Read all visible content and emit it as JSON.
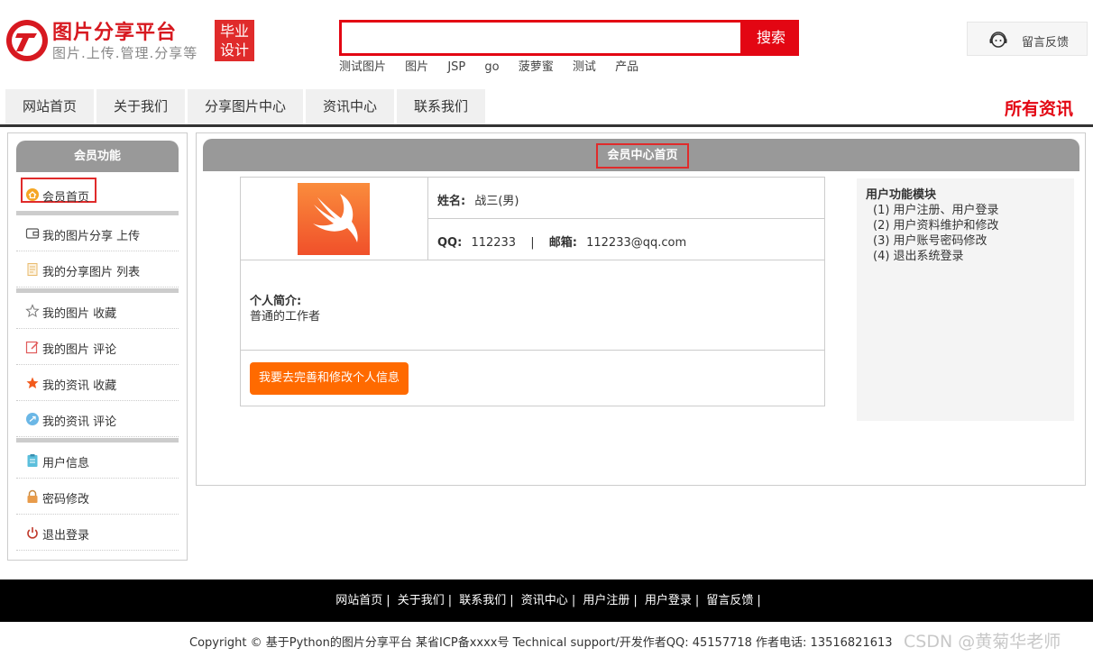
{
  "header": {
    "brand_title": "图片分享平台",
    "brand_subtitle": "图片.上传.管理.分享等",
    "badge_line1": "毕业",
    "badge_line2": "设计",
    "search_placeholder": "",
    "search_button": "搜索",
    "hot_words": [
      "测试图片",
      "图片",
      "JSP",
      "go",
      "菠萝蜜",
      "测试",
      "产品"
    ],
    "feedback_label": "留言反馈"
  },
  "nav": {
    "items": [
      "网站首页",
      "关于我们",
      "分享图片中心",
      "资讯中心",
      "联系我们"
    ],
    "right_link": "所有资讯"
  },
  "sidebar": {
    "title": "会员功能",
    "items": [
      {
        "label": "会员首页",
        "icon": "home-icon"
      },
      {
        "label": "我的图片分享 上传",
        "icon": "wallet-icon"
      },
      {
        "label": "我的分享图片 列表",
        "icon": "document-icon"
      },
      {
        "label": "我的图片 收藏",
        "icon": "star-outline-icon"
      },
      {
        "label": "我的图片 评论",
        "icon": "edit-icon"
      },
      {
        "label": "我的资讯 收藏",
        "icon": "star-filled-icon"
      },
      {
        "label": "我的资讯 评论",
        "icon": "chat-icon"
      },
      {
        "label": "用户信息",
        "icon": "clipboard-icon"
      },
      {
        "label": "密码修改",
        "icon": "lock-icon"
      },
      {
        "label": "退出登录",
        "icon": "power-icon"
      }
    ]
  },
  "main": {
    "title": "会员中心首页",
    "name_label": "姓名:",
    "name_value": "战三(男)",
    "qq_label": "QQ:",
    "qq_value": "112233",
    "separator": "|",
    "email_label": "邮箱:",
    "email_value": "112233@qq.com",
    "intro_label": "个人简介:",
    "intro_value": "普通的工作者",
    "edit_button": "我要去完善和修改个人信息"
  },
  "modules": {
    "title": "用户功能模块",
    "items": [
      "(1) 用户注册、用户登录",
      "(2) 用户资料维护和修改",
      "(3) 用户账号密码修改",
      "(4) 退出系统登录"
    ]
  },
  "footer": {
    "links": [
      "网站首页",
      "关于我们",
      "联系我们",
      "资讯中心",
      "用户注册",
      "用户登录",
      "留言反馈"
    ],
    "copyright": "Copyright © 基于Python的图片分享平台 某省ICP备xxxx号    Technical support/开发作者QQ: 45157718    作者电话: 13516821613",
    "watermark": "CSDN @黄菊华老师"
  },
  "colors": {
    "brand_red": "#e30613",
    "gray_header": "#999999",
    "orange_button": "#ff6a00"
  }
}
